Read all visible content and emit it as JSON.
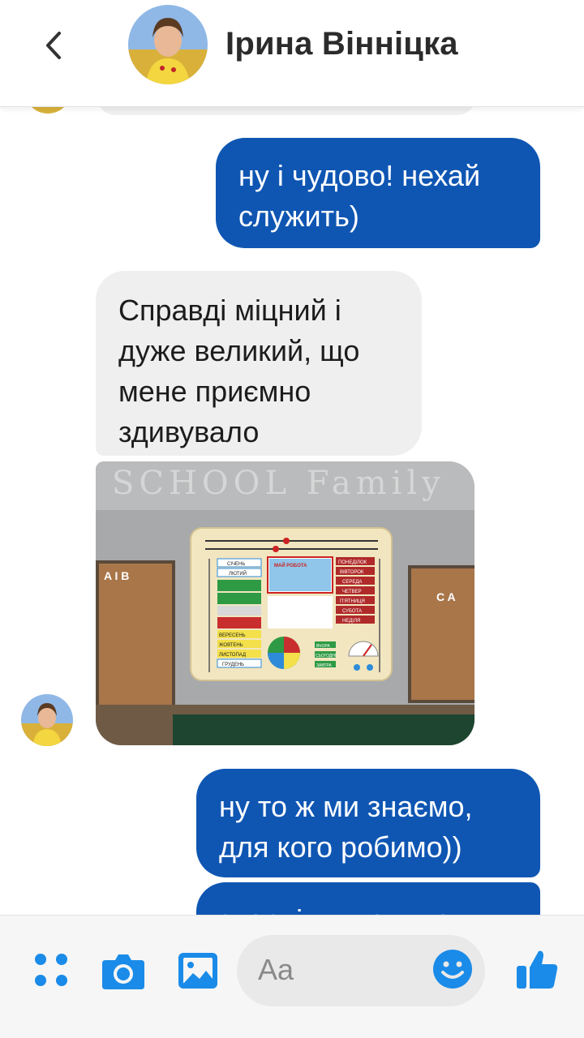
{
  "header": {
    "contact_name": "Ірина Вінніцка"
  },
  "messages": [
    {
      "direction": "outgoing",
      "text": "ну і чудово! нехай служить)"
    },
    {
      "direction": "incoming",
      "text": "Справді міцний і дуже великий, що мене приємно здивувало"
    },
    {
      "direction": "incoming",
      "type": "photo"
    },
    {
      "direction": "outgoing",
      "text": "ну то ж ми знаємо, для кого робимо))"
    },
    {
      "direction": "outgoing",
      "text": "зверніть увагу на"
    }
  ],
  "photo_board": {
    "watermark": "SCHOOL Family",
    "left_card": "A I B",
    "right_card": "C A",
    "months": [
      "СІЧЕНЬ",
      "ЛЮТИЙ",
      "ВЕРЕСЕНЬ",
      "ЖОВТЕНЬ",
      "ЛИСТОПАД",
      "ГРУДЕНЬ"
    ],
    "weekdays": [
      "ПОНЕДІЛОК",
      "ВІВТОРОК",
      "СЕРЕДА",
      "ЧЕТВЕР",
      "П'ЯТНИЦЯ",
      "СУБОТА",
      "НЕДІЛЯ"
    ],
    "center_title": "МАЙ РОБОТА",
    "small_labels": [
      "ВЧОРА",
      "СЬОГОДНІ",
      "ЗАВТРА"
    ]
  },
  "composer": {
    "placeholder": "Aa"
  },
  "colors": {
    "accent": "#0f56b3",
    "icon_blue": "#1a8be8",
    "incoming_bubble": "#efefef"
  },
  "icons": [
    "back-chevron-icon",
    "menu-dots-icon",
    "camera-icon",
    "gallery-icon",
    "emoji-icon",
    "thumbs-up-icon"
  ]
}
